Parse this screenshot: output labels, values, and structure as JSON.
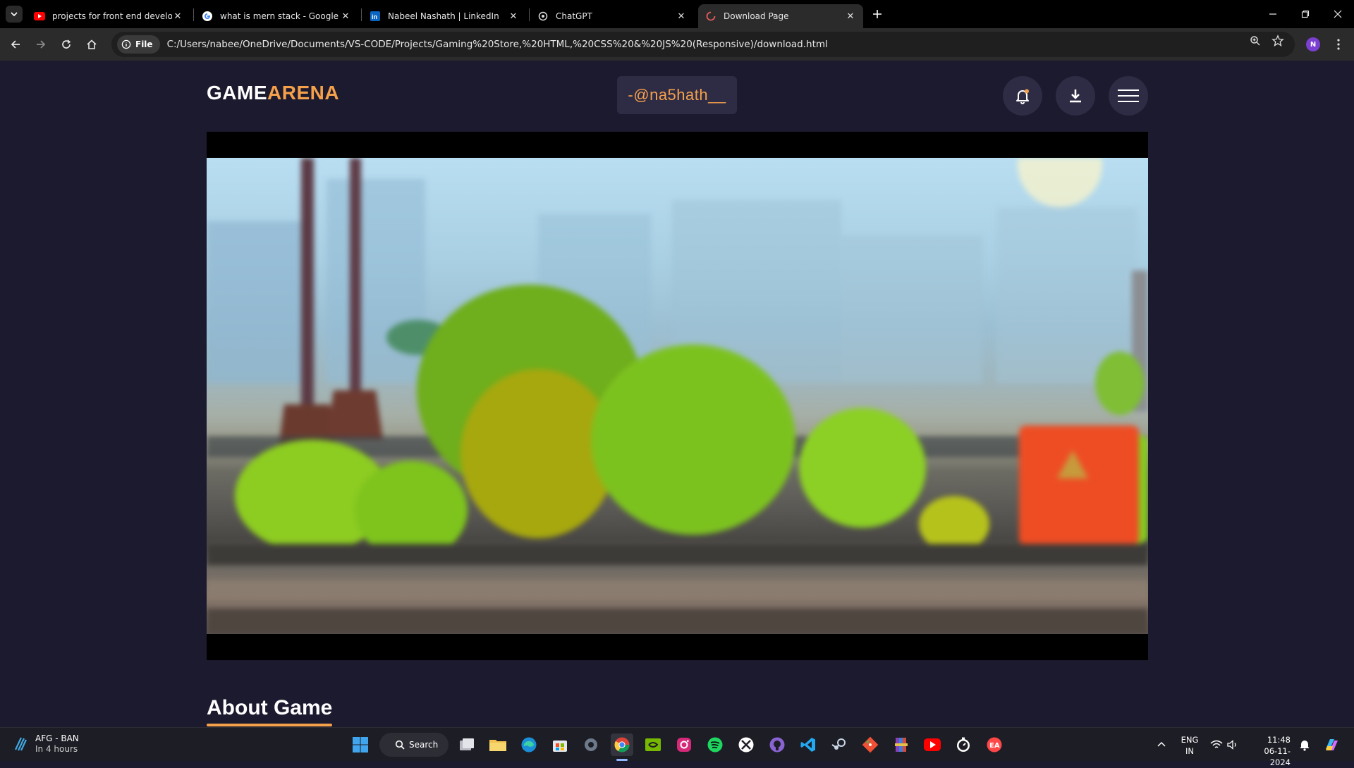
{
  "browser": {
    "tabs": [
      {
        "title": "projects for front end develope",
        "icon": "youtube-icon"
      },
      {
        "title": "what is mern stack - Google Se",
        "icon": "google-icon"
      },
      {
        "title": "Nabeel Nashath | LinkedIn",
        "icon": "linkedin-icon"
      },
      {
        "title": "ChatGPT",
        "icon": "chatgpt-icon"
      },
      {
        "title": "Download Page",
        "icon": "loading-icon",
        "active": true
      }
    ],
    "chip_label": "File",
    "url": "C:/Users/nabee/OneDrive/Documents/VS-CODE/Projects/Gaming%20Store,%20HTML,%20CSS%20&%20JS%20(Responsive)/download.html",
    "profile_initial": "N"
  },
  "site": {
    "logo_part1": "GAME",
    "logo_part2": "ARENA",
    "handle": "-@na5hath__",
    "accent_color": "#f5a04a",
    "background_color": "#1c1a2e",
    "about_heading": "About Game"
  },
  "taskbar": {
    "weather_title": "AFG - BAN",
    "weather_sub": "In 4 hours",
    "search_label": "Search",
    "lang_line1": "ENG",
    "lang_line2": "IN",
    "time": "11:48",
    "date": "06-11-2024"
  }
}
